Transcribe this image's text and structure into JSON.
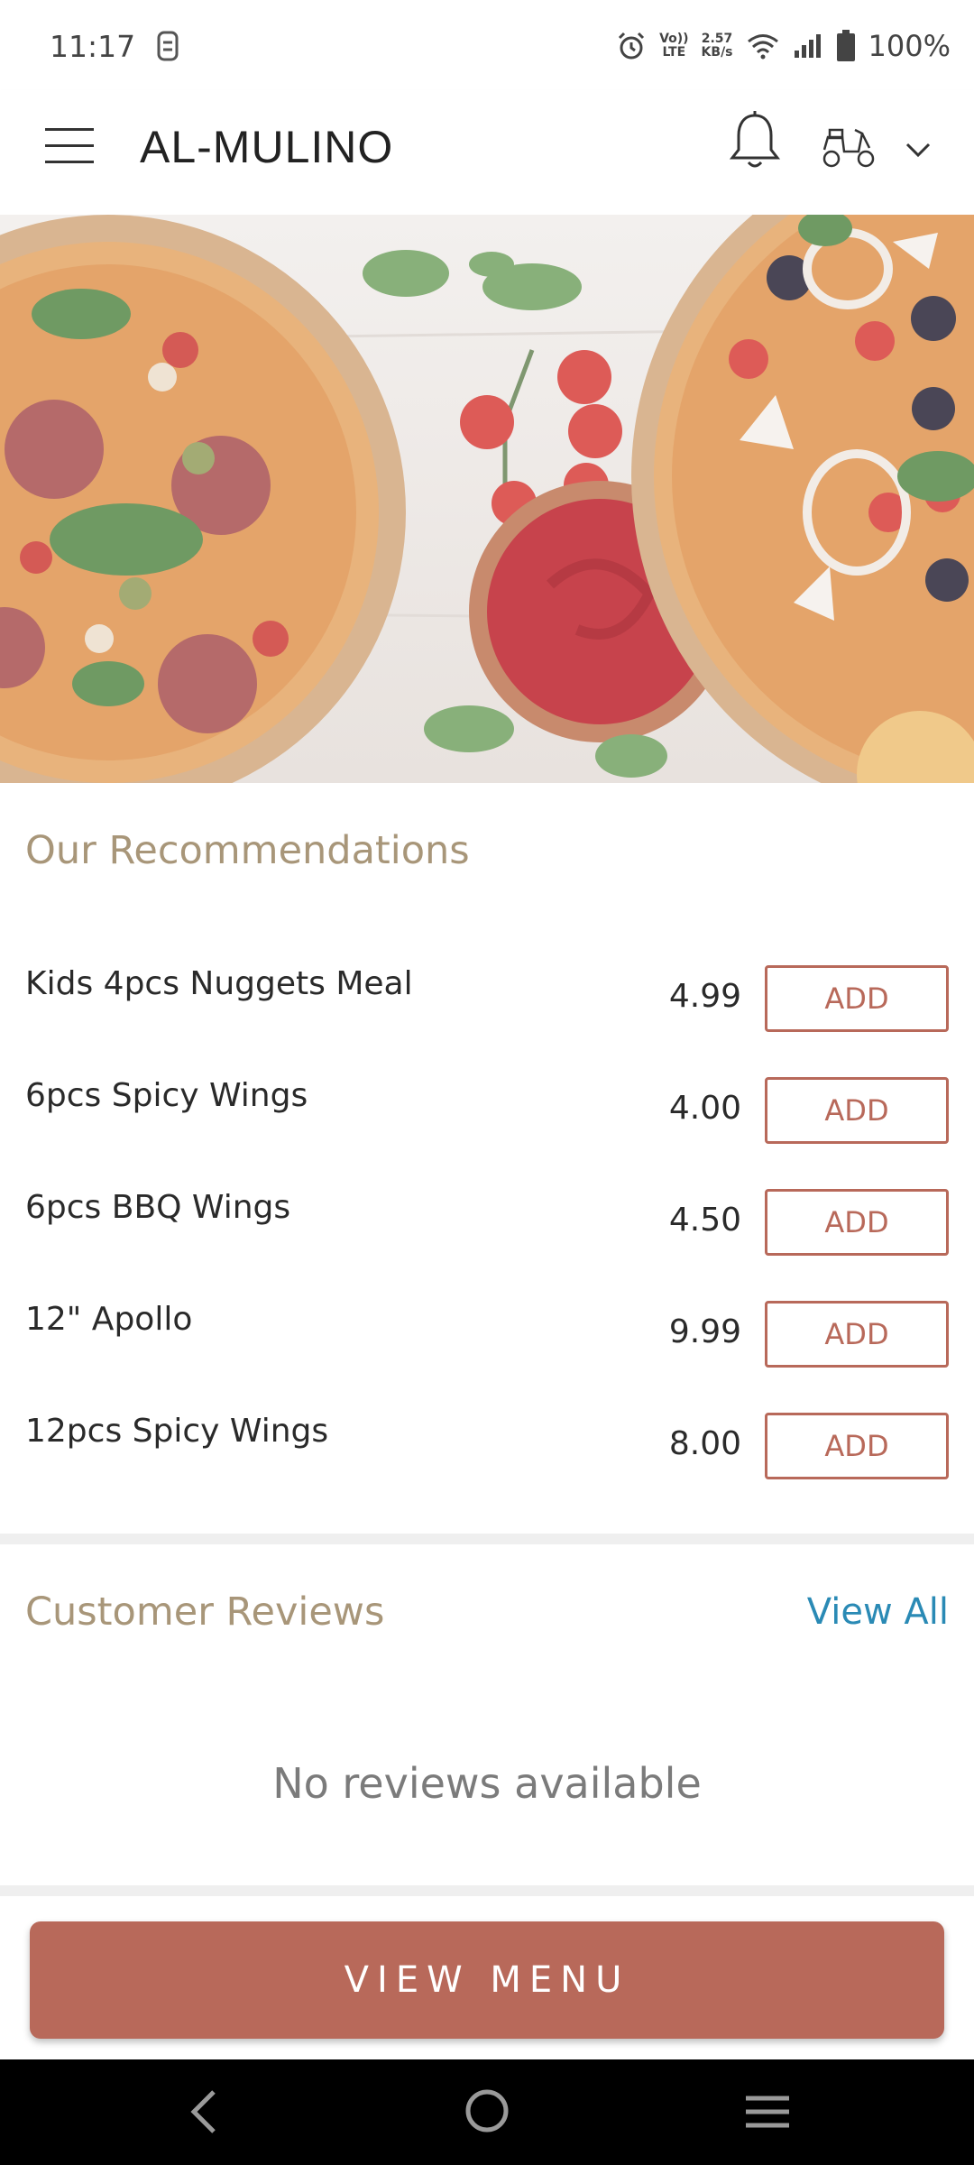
{
  "status": {
    "time": "11:17",
    "net_top": "2.57",
    "net_bottom": "KB/s",
    "volte_top": "Vo))",
    "volte_bottom": "LTE",
    "battery": "100%"
  },
  "header": {
    "title": "AL-MULINO",
    "icons": [
      "menu-icon",
      "bell-icon",
      "scooter-icon",
      "chevron-down-icon"
    ]
  },
  "recommendations": {
    "title": "Our Recommendations",
    "add_label": "ADD",
    "items": [
      {
        "name": "Kids 4pcs Nuggets Meal",
        "price": "4.99"
      },
      {
        "name": "6pcs Spicy Wings",
        "price": "4.00"
      },
      {
        "name": "6pcs BBQ Wings",
        "price": "4.50"
      },
      {
        "name": "12\" Apollo",
        "price": "9.99"
      },
      {
        "name": "12pcs Spicy Wings",
        "price": "8.00"
      }
    ]
  },
  "reviews": {
    "title": "Customer Reviews",
    "view_all": "View All",
    "empty": "No reviews available"
  },
  "footer": {
    "view_menu": "VIEW MENU"
  },
  "colors": {
    "accent": "#b8695a",
    "heading": "#a89679",
    "link": "#2a8ab5"
  }
}
